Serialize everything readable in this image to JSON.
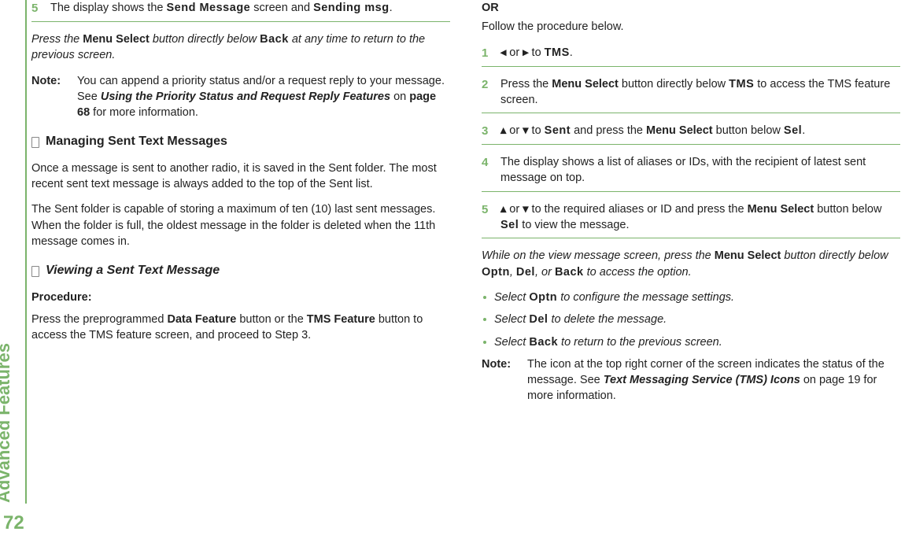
{
  "side_label": "Advanced Features",
  "page_number": "72",
  "left": {
    "step5_num": "5",
    "step5_a": "The display shows the ",
    "step5_b": "Send Message",
    "step5_c": " screen and ",
    "step5_d": "Sending msg",
    "step5_e": ".",
    "press_back_a": "Press the ",
    "press_back_b": "Menu Select",
    "press_back_c": " button directly below ",
    "press_back_d": "Back",
    "press_back_e": " at any time to return to the previous screen.",
    "note_label": "Note:",
    "note_a": "You can append a priority status and/or a request reply to your message. See ",
    "note_b": "Using the Priority Status and Request Reply Features",
    "note_c": " on ",
    "note_d": "page 68",
    "note_e": " for more information.",
    "heading1": "Managing Sent Text Messages",
    "para1": "Once a message is sent to another radio, it is saved in the Sent folder. The most recent sent text message is always added to the top of the Sent list.",
    "para2": "The Sent folder is capable of storing a maximum of ten (10) last sent messages. When the folder is full, the oldest message in the folder is deleted when the 11th message comes in.",
    "heading2": "Viewing a Sent Text Message",
    "procedure_label": "Procedure:",
    "proc_a": "Press the preprogrammed ",
    "proc_b": "Data Feature",
    "proc_c": " button or the ",
    "proc_d": "TMS Feature",
    "proc_e": " button to access the TMS feature screen, and proceed to Step 3."
  },
  "right": {
    "or_label": "OR",
    "or_follow": "Follow the procedure below.",
    "s1_num": "1",
    "s1_a": "◂",
    "s1_b": " or ",
    "s1_c": "▸",
    "s1_d": " to ",
    "s1_e": "TMS",
    "s1_f": ".",
    "s2_num": "2",
    "s2_a": "Press the ",
    "s2_b": "Menu Select",
    "s2_c": " button directly below ",
    "s2_d": "TMS",
    "s2_e": " to access the TMS feature screen.",
    "s3_num": "3",
    "s3_a": "▴",
    "s3_b": " or ",
    "s3_c": "▾",
    "s3_d": " to ",
    "s3_e": "Sent",
    "s3_f": " and press the ",
    "s3_g": "Menu Select",
    "s3_h": " button below ",
    "s3_i": "Sel",
    "s3_j": ".",
    "s4_num": "4",
    "s4_text": "The display shows a list of aliases or IDs, with the recipient of latest sent message on top.",
    "s5_num": "5",
    "s5_a": "▴",
    "s5_b": " or ",
    "s5_c": "▾",
    "s5_d": " to the required aliases or ID and press the ",
    "s5_e": "Menu Select",
    "s5_f": " button below ",
    "s5_g": "Sel",
    "s5_h": " to view the message.",
    "while_a": "While on the view message screen, press the ",
    "while_b": "Menu Select",
    "while_c": " button directly below ",
    "while_d": "Optn",
    "while_e": ", ",
    "while_f": "Del",
    "while_g": ", or ",
    "while_h": "Back",
    "while_i": " to access the option.",
    "b1_a": "Select ",
    "b1_b": "Optn",
    "b1_c": " to configure the message settings.",
    "b2_a": "Select ",
    "b2_b": "Del",
    "b2_c": " to delete the message.",
    "b3_a": "Select ",
    "b3_b": "Back",
    "b3_c": " to return to the previous screen.",
    "note_label": "Note:",
    "note_a": "The icon at the top right corner of the screen indicates the status of the message. See ",
    "note_b": "Text Messaging Service (TMS) Icons",
    "note_c": " on page 19 for more information."
  }
}
